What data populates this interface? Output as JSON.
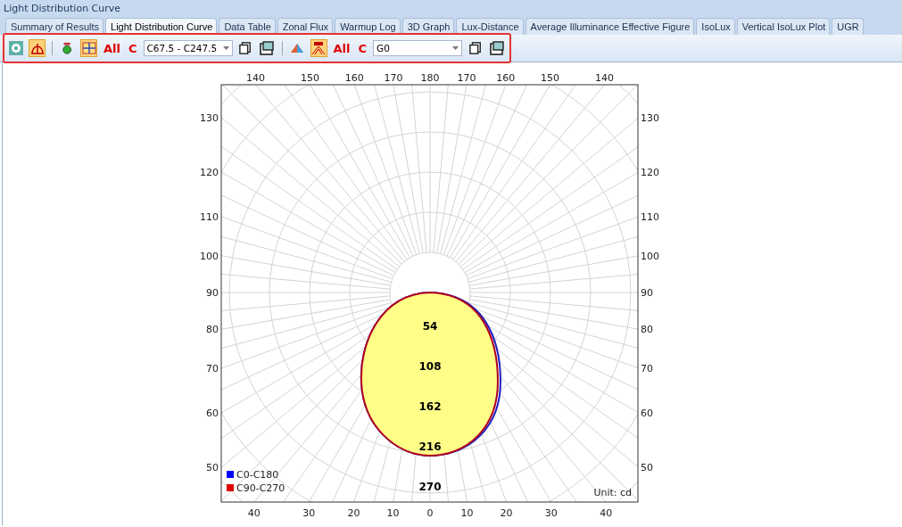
{
  "window": {
    "title": "Light Distribution Curve"
  },
  "tabs": [
    {
      "label": "Summary of Results",
      "selected": false
    },
    {
      "label": "Light Distribution Curve",
      "selected": true
    },
    {
      "label": "Data Table",
      "selected": false
    },
    {
      "label": "Zonal Flux",
      "selected": false
    },
    {
      "label": "Warmup Log",
      "selected": false
    },
    {
      "label": "3D Graph",
      "selected": false
    },
    {
      "label": "Lux-Distance",
      "selected": false
    },
    {
      "label": "Average Illuminance Effective Figure",
      "selected": false
    },
    {
      "label": "IsoLux",
      "selected": false
    },
    {
      "label": "Vertical IsoLux Plot",
      "selected": false
    },
    {
      "label": "UGR",
      "selected": false
    }
  ],
  "toolbar": {
    "highlighted": true,
    "items": [
      {
        "kind": "icon",
        "pressed": false
      },
      {
        "kind": "icon",
        "pressed": true
      },
      {
        "kind": "separator"
      },
      {
        "kind": "icon",
        "pressed": false
      },
      {
        "kind": "icon",
        "pressed": true
      },
      {
        "kind": "text",
        "label": "All"
      },
      {
        "kind": "text",
        "label": "C"
      },
      {
        "kind": "combo",
        "value": "C67.5 - C247.5"
      },
      {
        "kind": "icon",
        "pressed": false
      },
      {
        "kind": "icon",
        "pressed": false
      },
      {
        "kind": "separator"
      },
      {
        "kind": "icon",
        "pressed": false
      },
      {
        "kind": "icon",
        "pressed": true
      },
      {
        "kind": "text",
        "label": "All"
      },
      {
        "kind": "text",
        "label": "C"
      },
      {
        "kind": "combo",
        "value": "G0"
      },
      {
        "kind": "icon",
        "pressed": false
      },
      {
        "kind": "icon",
        "pressed": false
      }
    ]
  },
  "chart": {
    "top_labels": [
      "140",
      "150",
      "160",
      "170",
      "180",
      "170",
      "160",
      "150",
      "140"
    ],
    "bottom_labels": [
      "40",
      "30",
      "20",
      "10",
      "0",
      "10",
      "20",
      "30",
      "40"
    ],
    "left_labels": [
      "130",
      "120",
      "110",
      "100",
      "90",
      "80",
      "70",
      "60",
      "50"
    ],
    "right_labels": [
      "130",
      "120",
      "110",
      "100",
      "90",
      "80",
      "70",
      "60",
      "50"
    ],
    "ring_labels": [
      "54",
      "108",
      "162",
      "216",
      "270"
    ],
    "legend": [
      {
        "label": "C0-C180",
        "color": "#0000ff"
      },
      {
        "label": "C90-C270",
        "color": "#e00000"
      }
    ],
    "unit": "Unit: cd"
  }
}
